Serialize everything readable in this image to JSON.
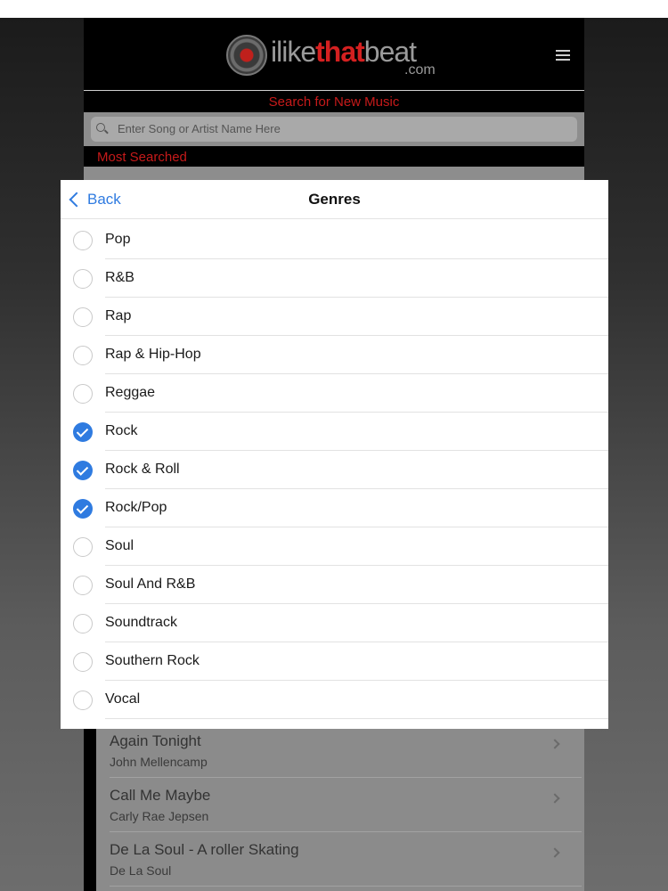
{
  "site": {
    "logo": {
      "part1": "ilike",
      "part2": "that",
      "part3": "beat",
      "suffix": ".com"
    },
    "search_title": "Search for New Music",
    "search_placeholder": "Enter Song or Artist Name Here",
    "most_searched": "Most Searched",
    "songs": [
      {
        "title": "Again Tonight",
        "artist": "John Mellencamp"
      },
      {
        "title": "Call Me Maybe",
        "artist": "Carly Rae Jepsen"
      },
      {
        "title": "De La Soul - A roller Skating",
        "artist": "De La Soul"
      }
    ]
  },
  "popover": {
    "back_label": "Back",
    "title": "Genres",
    "genres": [
      {
        "label": "Pop",
        "checked": false
      },
      {
        "label": "R&B",
        "checked": false
      },
      {
        "label": "Rap",
        "checked": false
      },
      {
        "label": "Rap & Hip-Hop",
        "checked": false
      },
      {
        "label": "Reggae",
        "checked": false
      },
      {
        "label": "Rock",
        "checked": true
      },
      {
        "label": "Rock & Roll",
        "checked": true
      },
      {
        "label": "Rock/Pop",
        "checked": true
      },
      {
        "label": "Soul",
        "checked": false
      },
      {
        "label": "Soul And R&B",
        "checked": false
      },
      {
        "label": "Soundtrack",
        "checked": false
      },
      {
        "label": "Southern Rock",
        "checked": false
      },
      {
        "label": "Vocal",
        "checked": false
      }
    ]
  },
  "colors": {
    "accent": "#2f7be0",
    "brand_red": "#c61a1a"
  },
  "icons": [
    "menu-icon",
    "search-icon",
    "back-chevron-icon",
    "chevron-right-icon",
    "checkmark-icon"
  ]
}
